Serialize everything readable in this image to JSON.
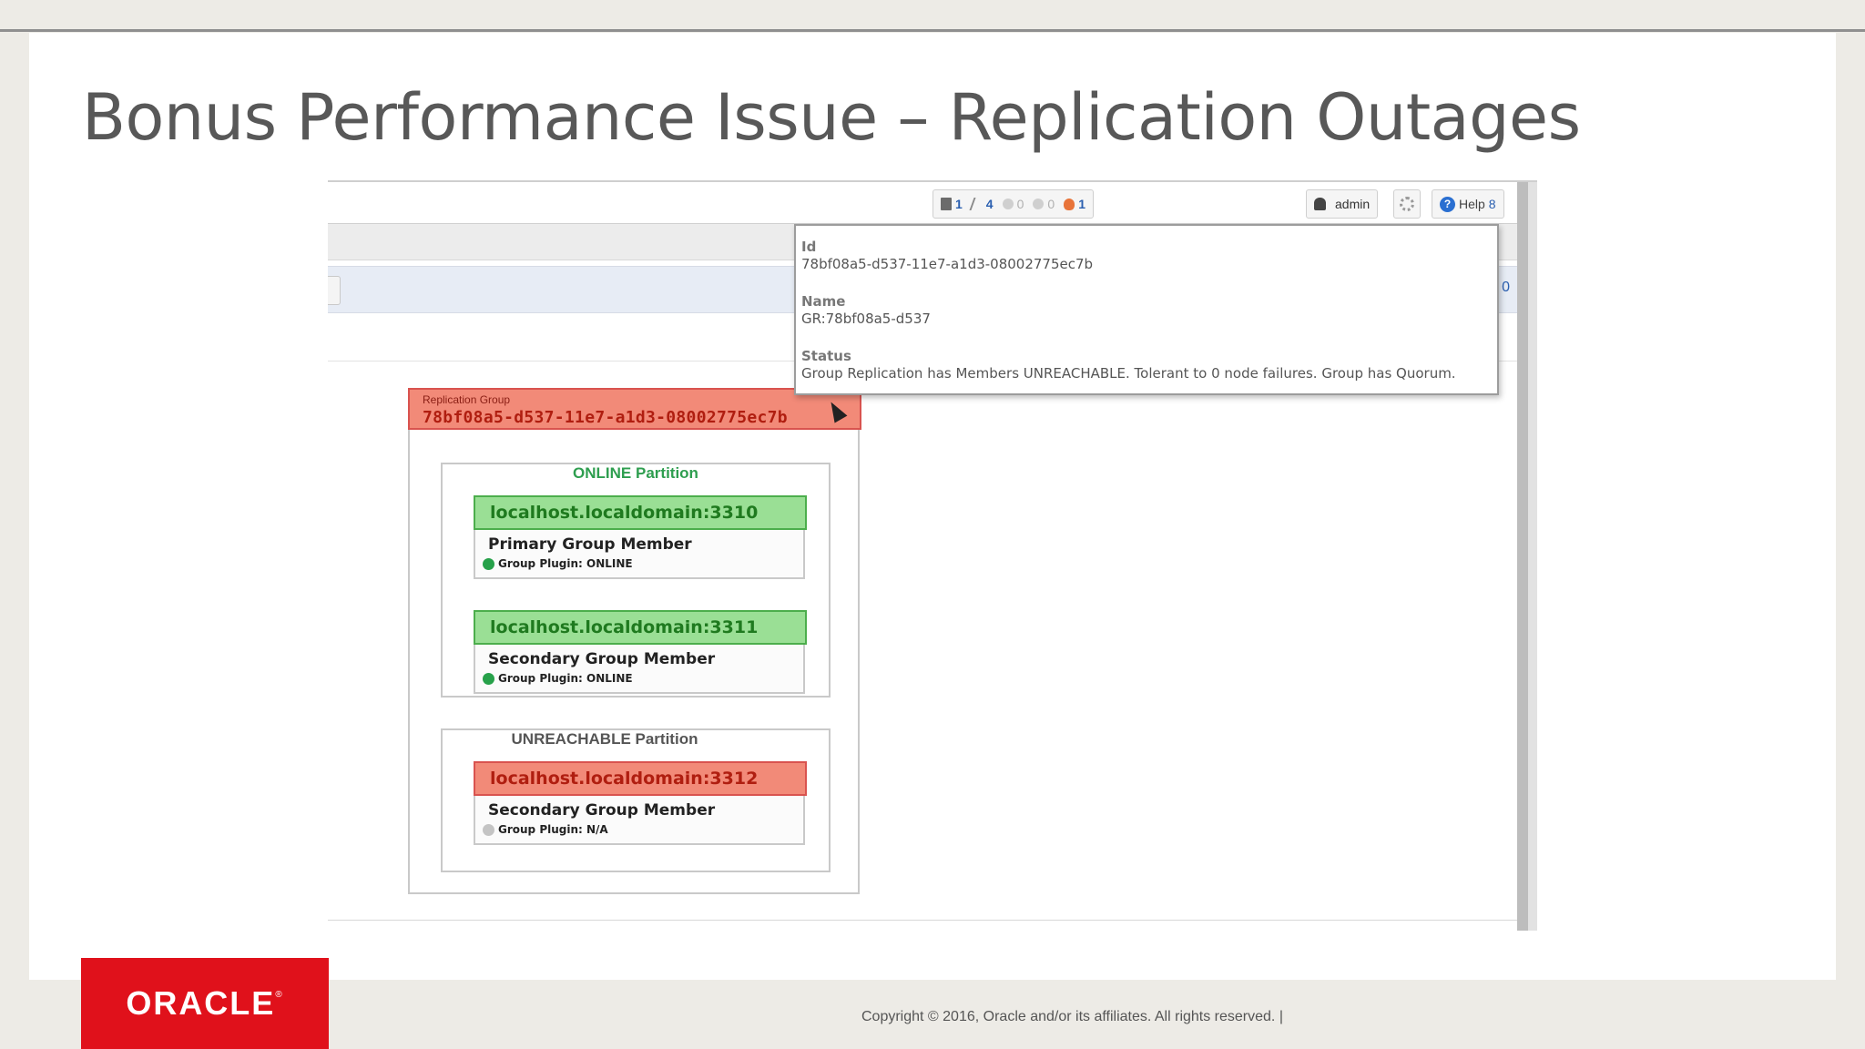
{
  "slide": {
    "title": "Bonus Performance Issue – Replication Outages"
  },
  "toolbar": {
    "stats": [
      {
        "icon": "server-icon",
        "value": "1",
        "active": true
      },
      {
        "icon": "connection-icon",
        "value": "4",
        "active": true
      },
      {
        "icon": "warning-grey-icon",
        "value": "0",
        "active": false
      },
      {
        "icon": "info-grey-icon",
        "value": "0",
        "active": false
      },
      {
        "icon": "fire-icon",
        "value": "1",
        "active": true
      }
    ],
    "user": "admin",
    "help": "Help",
    "help_suffix": "8"
  },
  "filterbar": {
    "right_text": "0"
  },
  "replication_group": {
    "kind_label": "Replication Group",
    "id": "78bf08a5-d537-11e7-a1d3-08002775ec7b"
  },
  "partitions": [
    {
      "title": "ONLINE Partition",
      "title_color": "#2e9e4f",
      "members": [
        {
          "host": "localhost.localdomain:3310",
          "role": "Primary Group Member",
          "plugin": "Group Plugin: ONLINE",
          "state": "ok"
        },
        {
          "host": "localhost.localdomain:3311",
          "role": "Secondary Group Member",
          "plugin": "Group Plugin: ONLINE",
          "state": "ok"
        }
      ]
    },
    {
      "title": "UNREACHABLE Partition",
      "title_color": "#555555",
      "members": [
        {
          "host": "localhost.localdomain:3312",
          "role": "Secondary Group Member",
          "plugin": "Group Plugin: N/A",
          "state": "bad"
        }
      ]
    }
  ],
  "tooltip": {
    "id_label": "Id",
    "id_value": "78bf08a5-d537-11e7-a1d3-08002775ec7b",
    "name_label": "Name",
    "name_value": "GR:78bf08a5-d537",
    "status_label": "Status",
    "status_value": "Group Replication has Members UNREACHABLE. Tolerant to 0 node failures. Group has Quorum."
  },
  "footer": {
    "logo": "ORACLE",
    "logo_mark": "®",
    "copyright": "Copyright © 2016, Oracle and/or its affiliates. All rights reserved.  |"
  },
  "colors": {
    "online_green": "#9adf95",
    "unreachable_red": "#f28a78",
    "oracle_red": "#e0111b"
  }
}
